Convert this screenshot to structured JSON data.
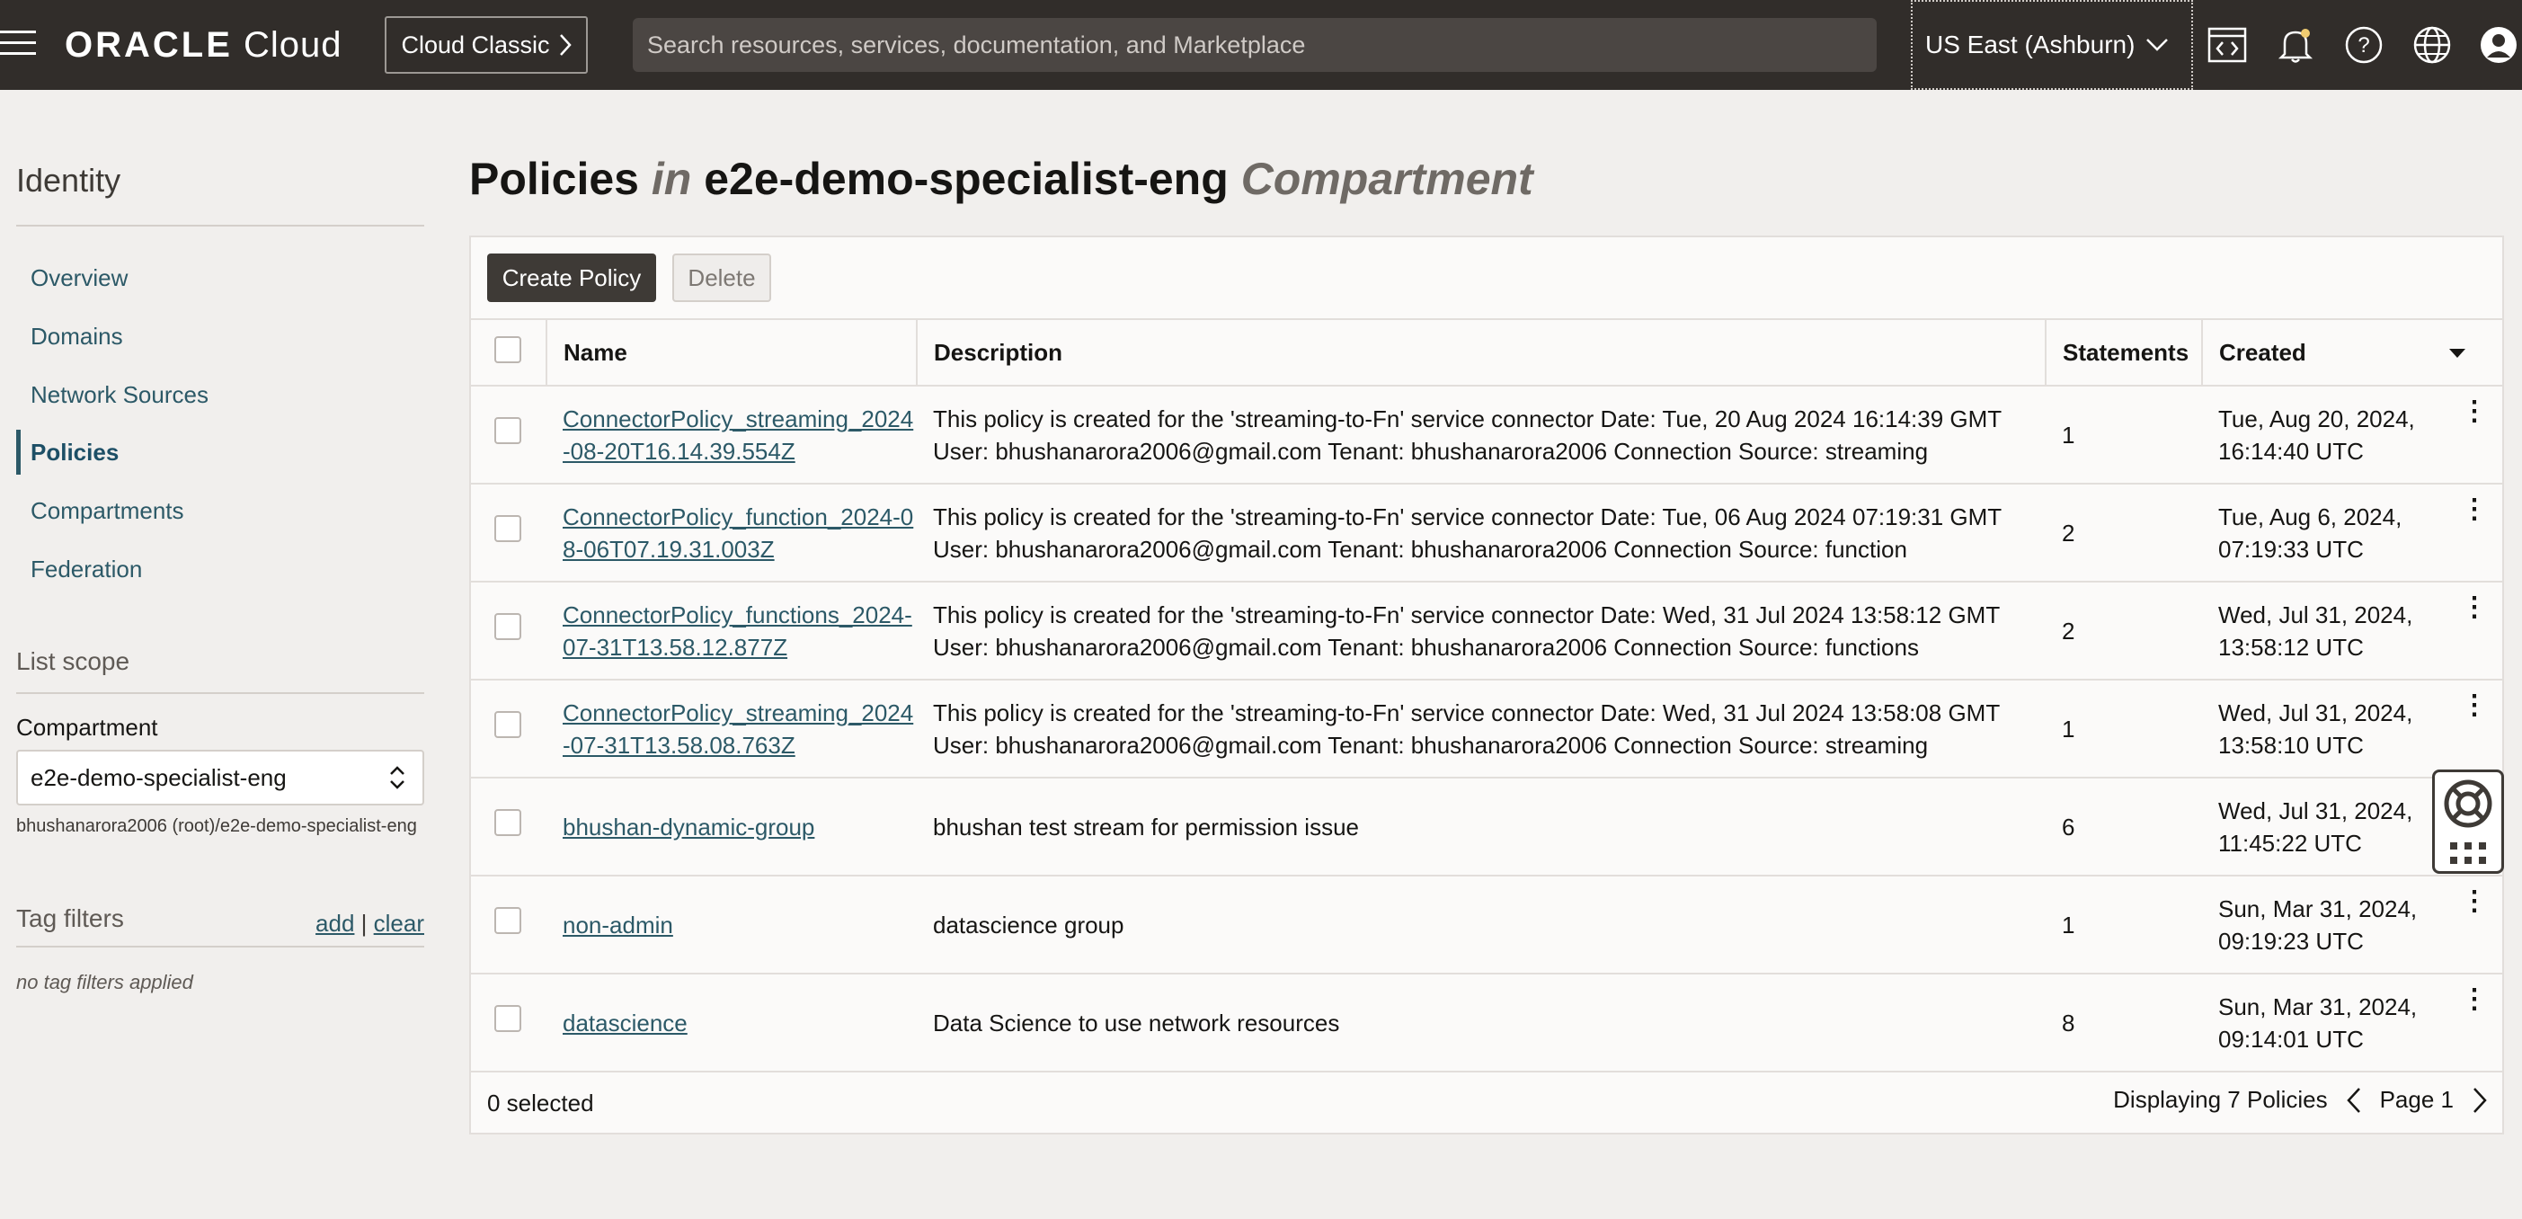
{
  "header": {
    "logo_brand": "ORACLE",
    "logo_product": "Cloud",
    "classic_label": "Cloud Classic",
    "search_placeholder": "Search resources, services, documentation, and Marketplace",
    "region": "US East (Ashburn)",
    "icons": [
      "menu-icon",
      "code-editor-icon",
      "bell-icon",
      "help-icon",
      "globe-icon",
      "profile-icon"
    ]
  },
  "sidebar": {
    "title": "Identity",
    "items": [
      {
        "label": "Overview",
        "active": false
      },
      {
        "label": "Domains",
        "active": false
      },
      {
        "label": "Network Sources",
        "active": false
      },
      {
        "label": "Policies",
        "active": true
      },
      {
        "label": "Compartments",
        "active": false
      },
      {
        "label": "Federation",
        "active": false
      }
    ],
    "list_scope": "List scope",
    "compartment_label": "Compartment",
    "compartment_value": "e2e-demo-specialist-eng",
    "compartment_path": "bhushanarora2006 (root)/e2e-demo-specialist-eng",
    "tag_filters": "Tag filters",
    "tag_add": "add",
    "tag_sep": " | ",
    "tag_clear": "clear",
    "tag_none": "no tag filters applied"
  },
  "main": {
    "title_prefix": "Policies",
    "title_in": "in",
    "title_compartment": "e2e-demo-specialist-eng",
    "title_suffix": "Compartment",
    "create_label": "Create Policy",
    "delete_label": "Delete",
    "columns": [
      "Name",
      "Description",
      "Statements",
      "Created"
    ],
    "rows": [
      {
        "name": "ConnectorPolicy_streaming_2024-08-20T16.14.39.554Z",
        "description": "This policy is created for the 'streaming-to-Fn' service connector Date: Tue, 20 Aug 2024 16:14:39 GMT User: bhushanarora2006@gmail.com Tenant: bhushanarora2006 Connection Source: streaming",
        "statements": "1",
        "created": "Tue, Aug 20, 2024, 16:14:40 UTC"
      },
      {
        "name": "ConnectorPolicy_function_2024-08-06T07.19.31.003Z",
        "description": "This policy is created for the 'streaming-to-Fn' service connector Date: Tue, 06 Aug 2024 07:19:31 GMT User: bhushanarora2006@gmail.com Tenant: bhushanarora2006 Connection Source: function",
        "statements": "2",
        "created": "Tue, Aug 6, 2024, 07:19:33 UTC"
      },
      {
        "name": "ConnectorPolicy_functions_2024-07-31T13.58.12.877Z",
        "description": "This policy is created for the 'streaming-to-Fn' service connector Date: Wed, 31 Jul 2024 13:58:12 GMT User: bhushanarora2006@gmail.com Tenant: bhushanarora2006 Connection Source: functions",
        "statements": "2",
        "created": "Wed, Jul 31, 2024, 13:58:12 UTC"
      },
      {
        "name": "ConnectorPolicy_streaming_2024-07-31T13.58.08.763Z",
        "description": "This policy is created for the 'streaming-to-Fn' service connector Date: Wed, 31 Jul 2024 13:58:08 GMT User: bhushanarora2006@gmail.com Tenant: bhushanarora2006 Connection Source: streaming",
        "statements": "1",
        "created": "Wed, Jul 31, 2024, 13:58:10 UTC"
      },
      {
        "name": "bhushan-dynamic-group",
        "description": "bhushan test stream for permission issue",
        "statements": "6",
        "created": "Wed, Jul 31, 2024, 11:45:22 UTC"
      },
      {
        "name": "non-admin",
        "description": "datascience group",
        "statements": "1",
        "created": "Sun, Mar 31, 2024, 09:19:23 UTC"
      },
      {
        "name": "datascience",
        "description": "Data Science to use network resources",
        "statements": "8",
        "created": "Sun, Mar 31, 2024, 09:14:01 UTC"
      }
    ],
    "selected_count": "0 selected",
    "displaying": "Displaying 7 Policies",
    "page": "Page 1"
  }
}
